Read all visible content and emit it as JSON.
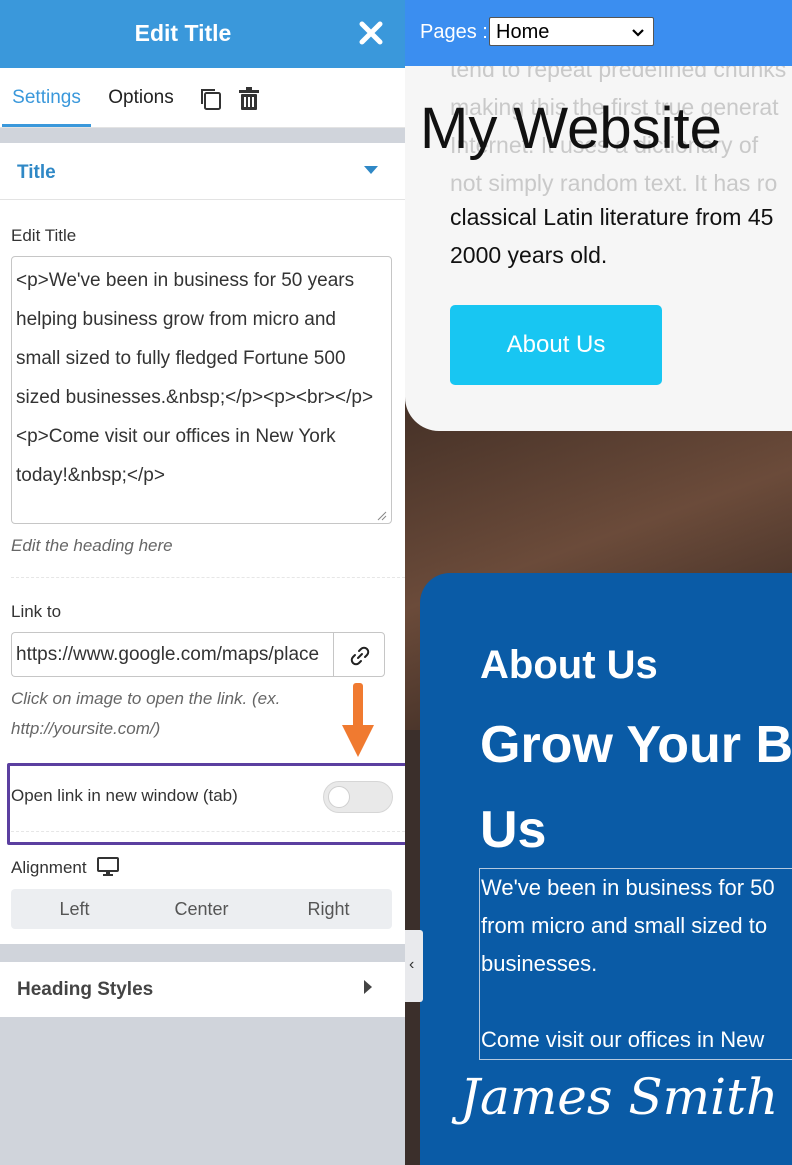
{
  "panel": {
    "title": "Edit Title",
    "tabs": [
      "Settings",
      "Options"
    ],
    "title_section": "Title",
    "edit_title_label": "Edit Title",
    "edit_title_value": "<p>We've been in business for 50 years\nhelping business grow from micro and\nsmall sized to fully fledged Fortune 500\nsized businesses.&nbsp;</p><p><br></p>\n<p>Come visit our offices in New York\ntoday!&nbsp;</p>",
    "edit_title_help": "Edit the heading here",
    "link_label": "Link to",
    "link_value": "https://www.google.com/maps/place",
    "link_help": "Click on image to open the link. (ex.\nhttp://yoursite.com/)",
    "new_window_label": "Open link in new window (tab)",
    "new_window_enabled": false,
    "alignment_label": "Alignment",
    "alignment_options": [
      "Left",
      "Center",
      "Right"
    ],
    "heading_styles_section": "Heading Styles"
  },
  "preview": {
    "pages_label": "Pages :",
    "pages_selected": "Home",
    "faded_text": "tend to repeat predefined chunks\nmaking this the first true generat\nInternet. It uses a dictionary of\nnot simply random text. It has ro",
    "site_title": "My Website",
    "hero_text": "classical Latin literature from 45\n2000 years old.",
    "about_button": "About Us",
    "about_heading": "About Us",
    "grow_heading": "Grow Your B\nUs",
    "body_text": "We've been in business for 50\nfrom micro and small sized to\nbusinesses.\n\nCome visit our offices in New",
    "signature": "James Smith"
  },
  "colors": {
    "header_blue": "#3a98db",
    "topbar_blue": "#3b8ef0",
    "section_blue": "#0a5ba6",
    "button_cyan": "#18c6f2",
    "highlight_purple": "#5b3fa0",
    "arrow_orange": "#f07a30"
  },
  "icons": {
    "close": "close-icon",
    "copy": "copy-icon",
    "trash": "trash-icon",
    "link": "link-icon",
    "monitor": "monitor-icon",
    "caret_down": "caret-down-icon",
    "caret_right": "caret-right-icon",
    "collapse": "chevron-left-icon"
  }
}
